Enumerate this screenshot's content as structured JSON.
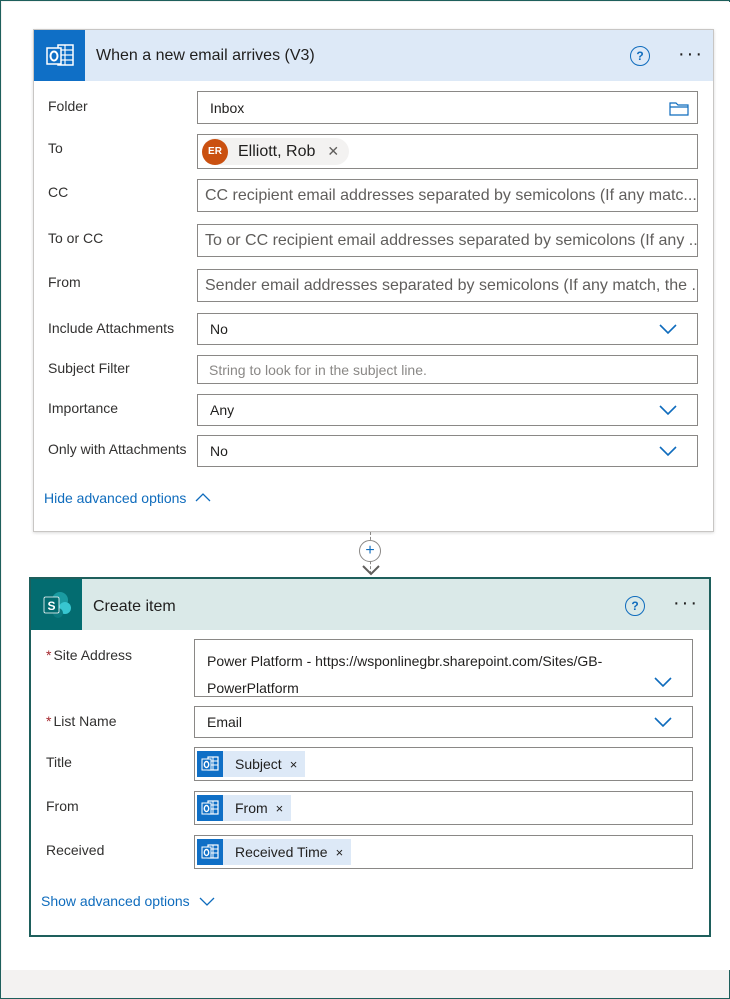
{
  "trigger_card": {
    "title": "When a new email arrives (V3)",
    "help_label": "?",
    "more_label": "···",
    "fields": {
      "folder": {
        "label": "Folder",
        "value": "Inbox"
      },
      "to": {
        "label": "To",
        "recipient_initials": "ER",
        "recipient_name": "Elliott, Rob",
        "remove_label": "✕"
      },
      "cc": {
        "label": "CC",
        "placeholder": "CC recipient email addresses separated by semicolons (If any matc..."
      },
      "to_or_cc": {
        "label": "To or CC",
        "placeholder": "To or CC recipient email addresses separated by semicolons (If any ..."
      },
      "from": {
        "label": "From",
        "placeholder": "Sender email addresses separated by semicolons (If any match, the ..."
      },
      "include_attachments": {
        "label": "Include Attachments",
        "value": "No"
      },
      "subject_filter": {
        "label": "Subject Filter",
        "placeholder": "String to look for in the subject line."
      },
      "importance": {
        "label": "Importance",
        "value": "Any"
      },
      "only_with_attachments": {
        "label": "Only with Attachments",
        "value": "No"
      }
    },
    "advanced_link": "Hide advanced options"
  },
  "connector": {
    "plus_label": "+"
  },
  "action_card": {
    "title": "Create item",
    "help_label": "?",
    "more_label": "···",
    "required_mark": "*",
    "fields": {
      "site_address": {
        "label": "Site Address",
        "value_line1": "Power Platform - https://wsponlinegbr.sharepoint.com/Sites/GB-",
        "value_line2": "PowerPlatform"
      },
      "list_name": {
        "label": "List Name",
        "value": "Email"
      },
      "title": {
        "label": "Title",
        "token": "Subject",
        "remove_label": "×"
      },
      "from": {
        "label": "From",
        "token": "From",
        "remove_label": "×"
      },
      "received": {
        "label": "Received",
        "token": "Received Time",
        "remove_label": "×"
      }
    },
    "advanced_link": "Show advanced options"
  },
  "colors": {
    "outlook_blue": "#0f6fc6",
    "sharepoint_teal": "#036c70",
    "link_blue": "#0f6cbd",
    "card_border_teal": "#1e5f5c",
    "avatar_orange": "#ca5010"
  },
  "icons": [
    "outlook-icon",
    "sharepoint-icon",
    "help-icon",
    "more-icon",
    "folder-icon",
    "chevron-down-icon",
    "chevron-up-icon",
    "close-icon",
    "plus-icon",
    "arrow-down-icon"
  ]
}
